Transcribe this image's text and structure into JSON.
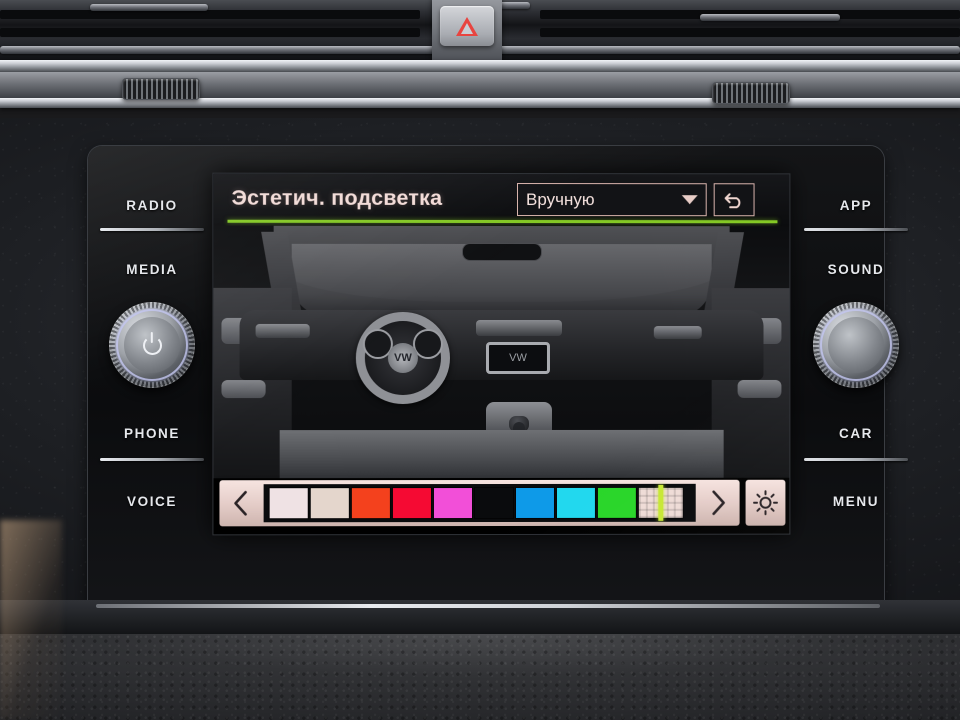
{
  "device": {
    "name": "Volkswagen Discover Media infotainment unit",
    "hazard_icon": "hazard-triangle-icon"
  },
  "left_buttons": [
    {
      "label": "RADIO",
      "name": "radio-button"
    },
    {
      "label": "MEDIA",
      "name": "media-button"
    },
    {
      "label": "PHONE",
      "name": "phone-button"
    },
    {
      "label": "VOICE",
      "name": "voice-button"
    }
  ],
  "right_buttons": [
    {
      "label": "APP",
      "name": "app-button"
    },
    {
      "label": "SOUND",
      "name": "sound-button"
    },
    {
      "label": "CAR",
      "name": "car-button"
    },
    {
      "label": "MENU",
      "name": "menu-button"
    }
  ],
  "knobs": {
    "left": {
      "name": "power-volume-knob",
      "icon": "power-icon"
    },
    "right": {
      "name": "tuning-knob",
      "icon": "blank"
    }
  },
  "screen": {
    "title": "Эстетич. подсветка",
    "accent_color": "#84c825",
    "title_color": "#f3dcd8",
    "dropdown": {
      "value": "Вручную",
      "icon": "chevron-down-icon"
    },
    "back_button": {
      "icon": "undo-arrow-icon"
    },
    "illustration": {
      "alt": "Vehicle interior ambient lighting preview",
      "badge": "VW",
      "head_unit_label": "VW"
    },
    "palette": {
      "prev_icon": "chevron-left-icon",
      "next_icon": "chevron-right-icon",
      "brightness_icon": "sun-icon",
      "swatches": [
        {
          "name": "swatch-white",
          "color": "#efe2e4",
          "selected": false
        },
        {
          "name": "swatch-cream",
          "color": "#e4d6cc",
          "selected": false
        },
        {
          "name": "swatch-orange-red",
          "color": "#f4411d",
          "selected": false
        },
        {
          "name": "swatch-red",
          "color": "#f50a33",
          "selected": false
        },
        {
          "name": "swatch-magenta",
          "color": "#f24fd8",
          "selected": false
        },
        {
          "name": "swatch-purple",
          "color": "#a濾",
          "selected": false
        },
        {
          "name": "swatch-blue",
          "color": "#0e9ae8",
          "selected": false
        },
        {
          "name": "swatch-cyan",
          "color": "#22d8ee",
          "selected": false
        },
        {
          "name": "swatch-green",
          "color": "#2ad62a",
          "selected": false
        },
        {
          "name": "swatch-current",
          "color": "#c8e835",
          "selected": true
        }
      ]
    }
  }
}
